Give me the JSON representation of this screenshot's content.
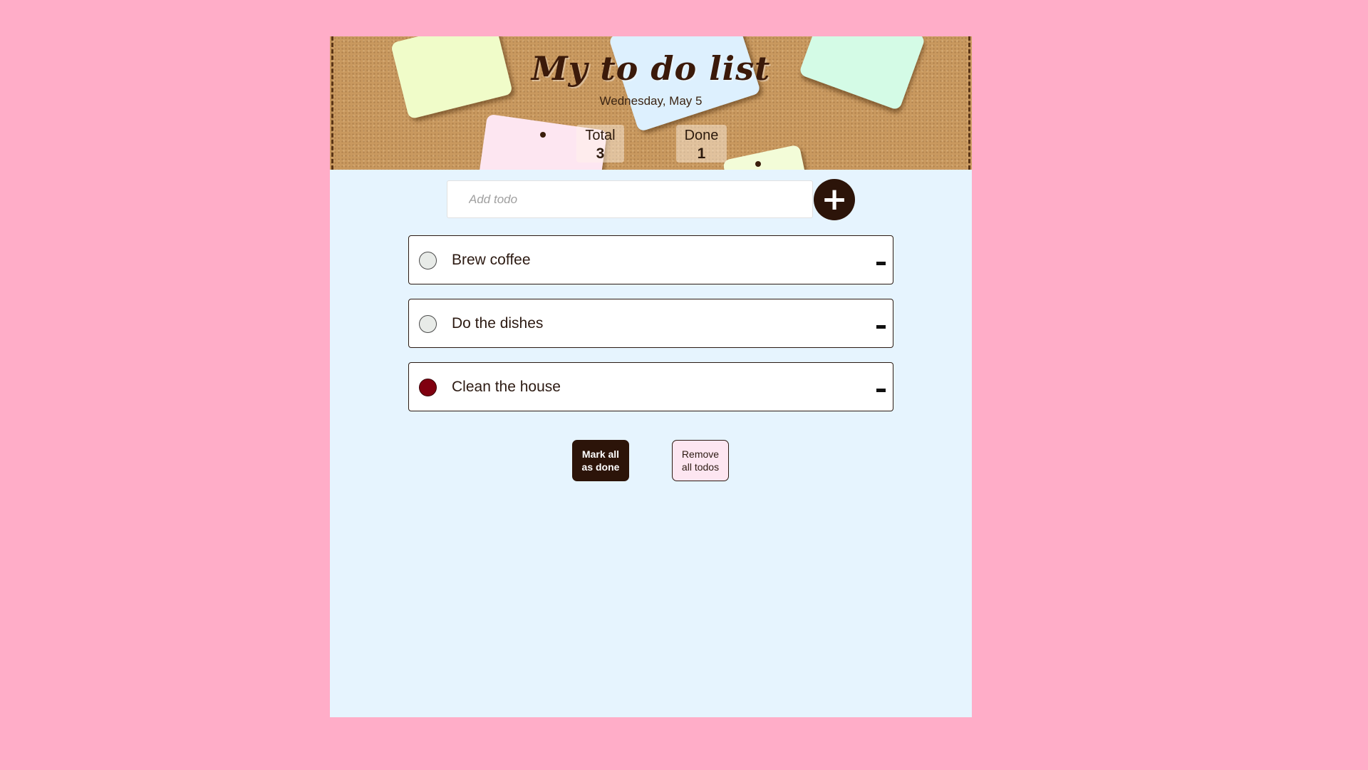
{
  "header": {
    "title": "My to do list",
    "date": "Wednesday, May 5",
    "stats": {
      "total_label": "Total",
      "total_value": "3",
      "done_label": "Done",
      "done_value": "1"
    }
  },
  "add": {
    "placeholder": "Add todo",
    "value": "",
    "button_label": "+"
  },
  "todos": [
    {
      "text": "Brew coffee",
      "done": false
    },
    {
      "text": "Do the dishes",
      "done": false
    },
    {
      "text": "Clean the house",
      "done": true
    }
  ],
  "actions": {
    "mark_all_label": "Mark all\nas done",
    "remove_all_label": "Remove\nall todos"
  },
  "colors": {
    "page_background": "#ffadc8",
    "panel_background": "#e6f4fe",
    "cork": "#c9995f",
    "accent_dark": "#2c1409",
    "done_check": "#800010"
  },
  "icons": {
    "add": "plus-icon",
    "remove": "minus-icon"
  }
}
